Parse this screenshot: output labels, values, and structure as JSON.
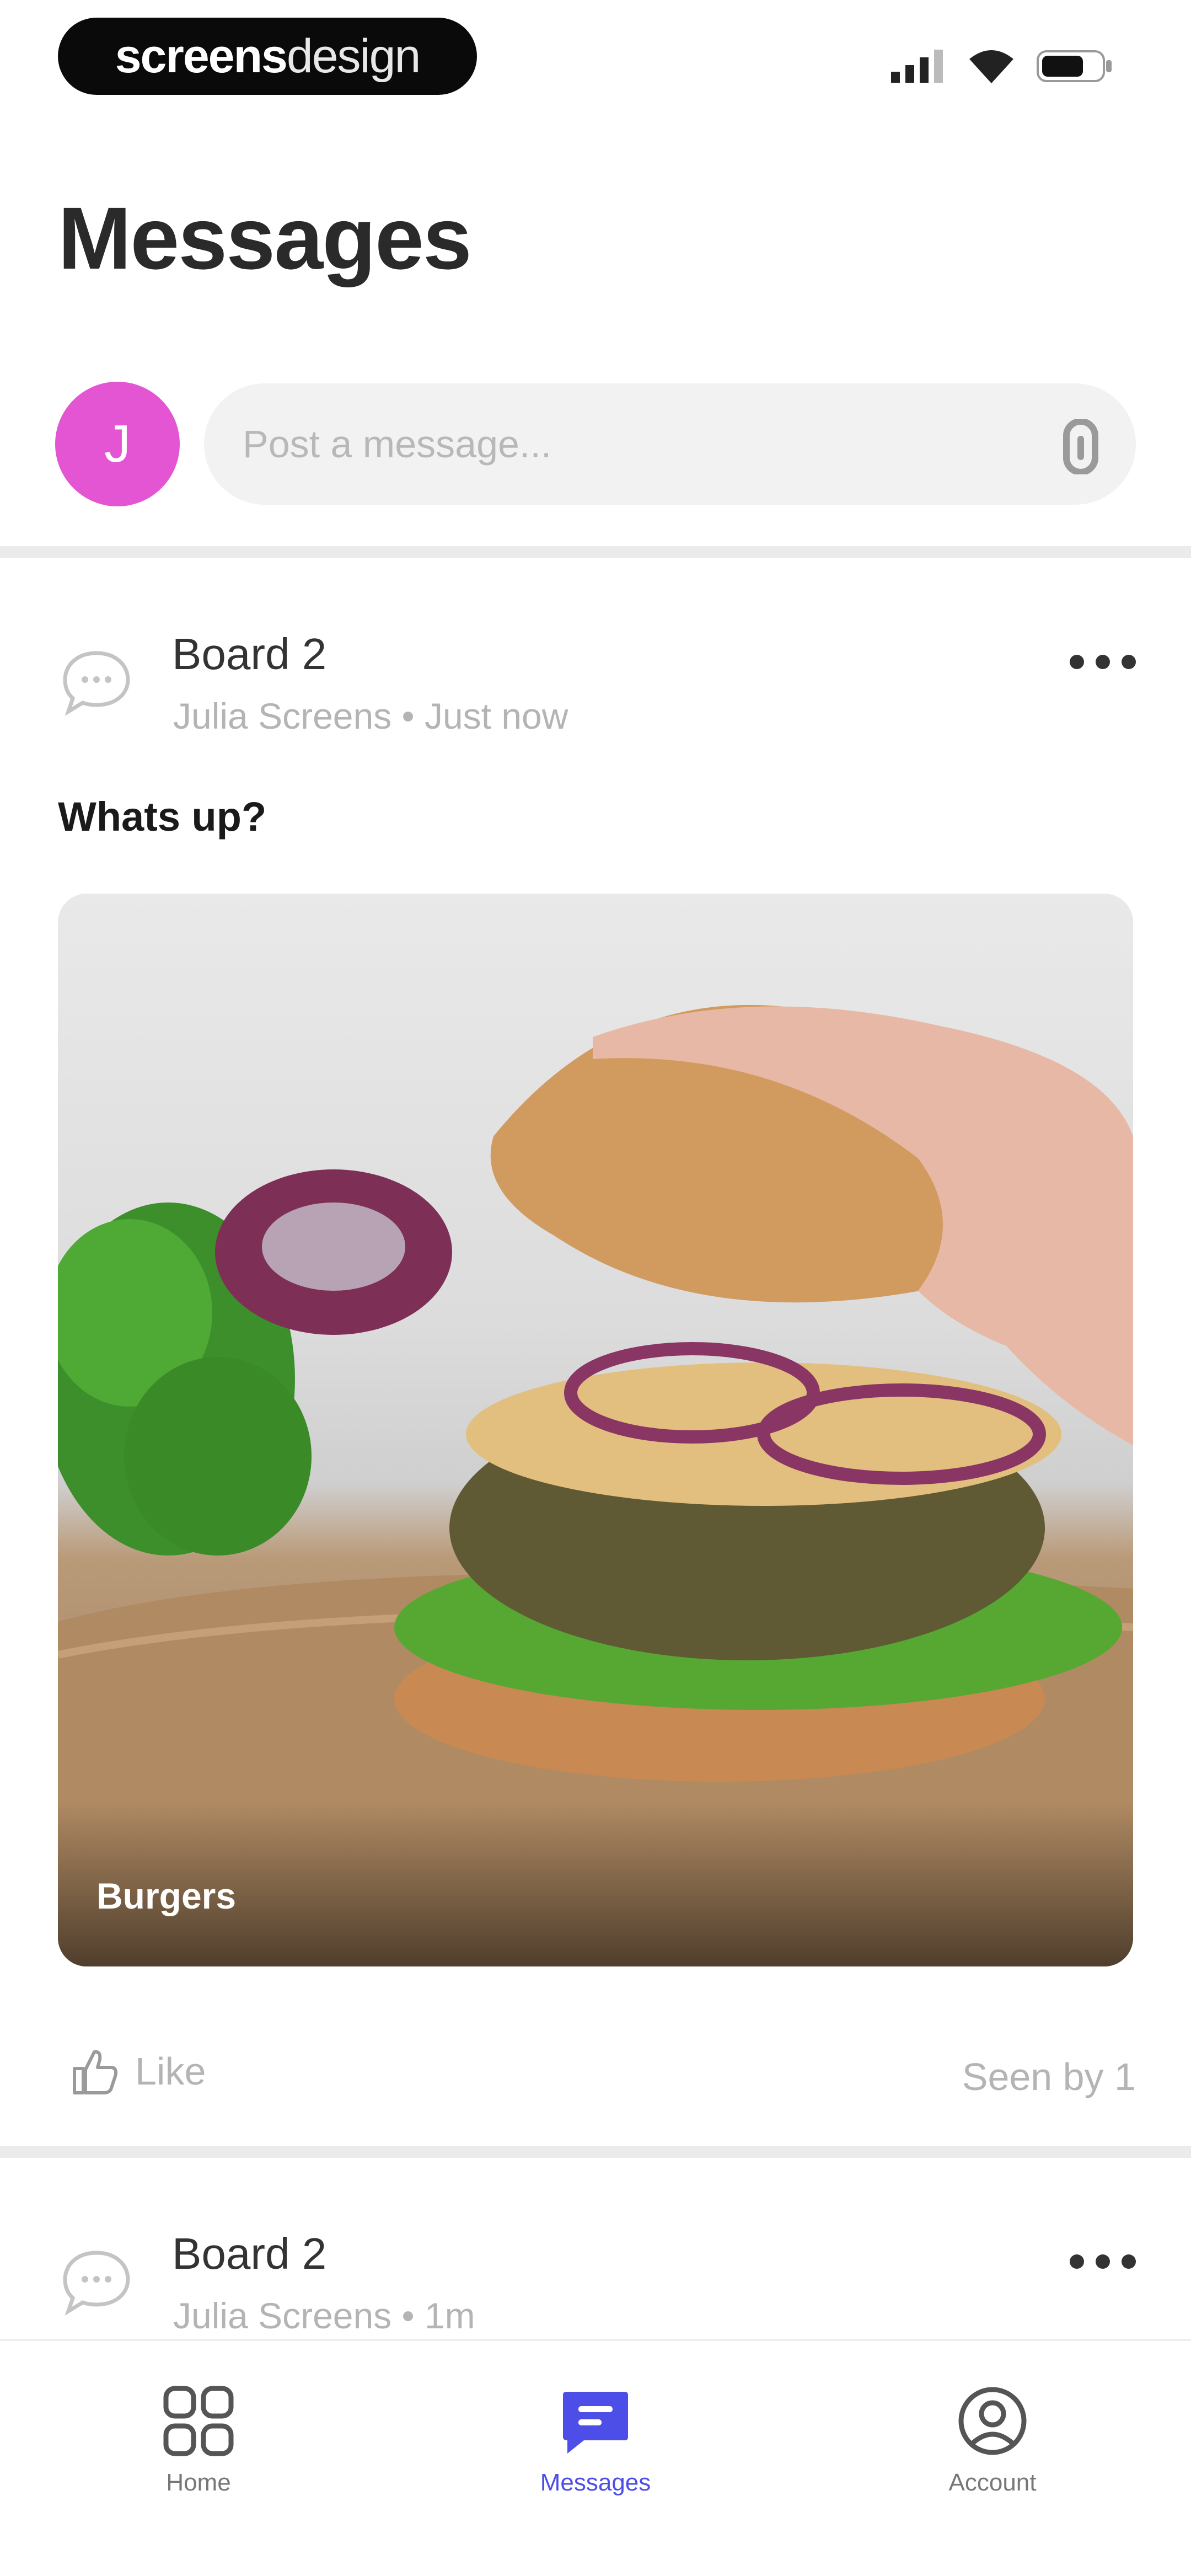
{
  "status_bar": {
    "brand_bold": "screens",
    "brand_light": "design",
    "icons": [
      "signal-icon",
      "wifi-icon",
      "battery-icon"
    ]
  },
  "page": {
    "title": "Messages"
  },
  "composer": {
    "avatar_initial": "J",
    "avatar_color": "#e455d4",
    "placeholder": "Post a message...",
    "value": ""
  },
  "posts": [
    {
      "board": "Board 2",
      "meta": "Julia Screens • Just now",
      "text": "Whats up?",
      "image_caption": "Burgers",
      "like_label": "Like",
      "seen_by": "Seen by 1"
    },
    {
      "board": "Board 2",
      "meta": "Julia Screens • 1m"
    }
  ],
  "tab_bar": {
    "tabs": [
      {
        "label": "Home",
        "icon": "grid-icon"
      },
      {
        "label": "Messages",
        "icon": "chat-icon",
        "active": true
      },
      {
        "label": "Account",
        "icon": "account-icon"
      }
    ],
    "accent_color": "#4d4de8"
  }
}
